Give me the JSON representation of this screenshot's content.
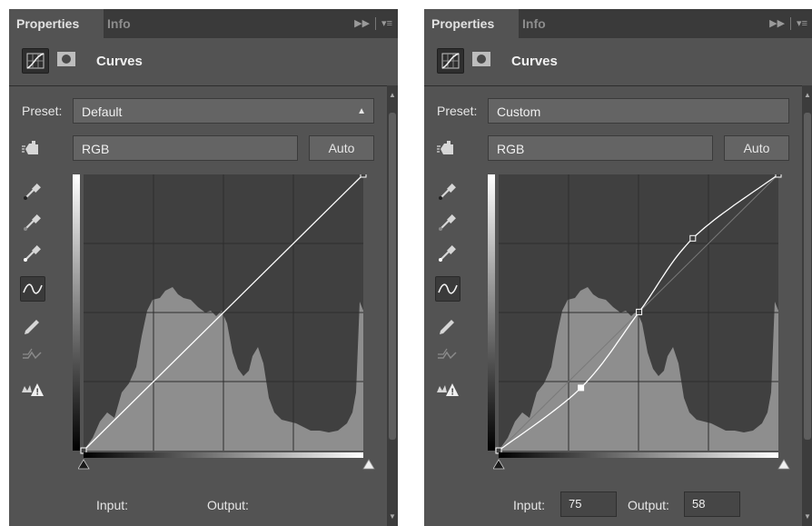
{
  "panels": [
    {
      "tabs": [
        "Properties",
        "Info"
      ],
      "title": "Curves",
      "preset_label": "Preset:",
      "preset_value": "Default",
      "channel_value": "RGB",
      "auto_label": "Auto",
      "input_label": "Input:",
      "input_value": "",
      "output_label": "Output:",
      "output_value": "",
      "curve_points": [
        [
          0,
          0
        ],
        [
          255,
          255
        ]
      ]
    },
    {
      "tabs": [
        "Properties",
        "Info"
      ],
      "title": "Curves",
      "preset_label": "Preset:",
      "preset_value": "Custom",
      "channel_value": "RGB",
      "auto_label": "Auto",
      "input_label": "Input:",
      "input_value": "75",
      "output_label": "Output:",
      "output_value": "58",
      "curve_points": [
        [
          0,
          0
        ],
        [
          75,
          58
        ],
        [
          128,
          128
        ],
        [
          177,
          196
        ],
        [
          255,
          255
        ]
      ],
      "selected_point": 1
    }
  ],
  "icons": {
    "tab_menu": "double-chevron-menu-icon",
    "adjustment": "curves-adjustment-icon",
    "mask": "layer-mask-icon",
    "targeted_adjustment": "hand-adjust-icon",
    "eyedroppers": [
      "black-point-eyedropper-icon",
      "gray-point-eyedropper-icon",
      "white-point-eyedropper-icon"
    ],
    "smooth_curve": "edit-points-curve-icon",
    "pencil": "pencil-draw-icon",
    "smooth": "smooth-curve-icon",
    "clipping": "clipping-warning-icon"
  },
  "colors": {
    "panel_bg": "#535353",
    "tab_bar": "#3a3a3a",
    "graph_bg": "#404040",
    "histogram": "#8e8e8e",
    "curve": "#ffffff"
  }
}
